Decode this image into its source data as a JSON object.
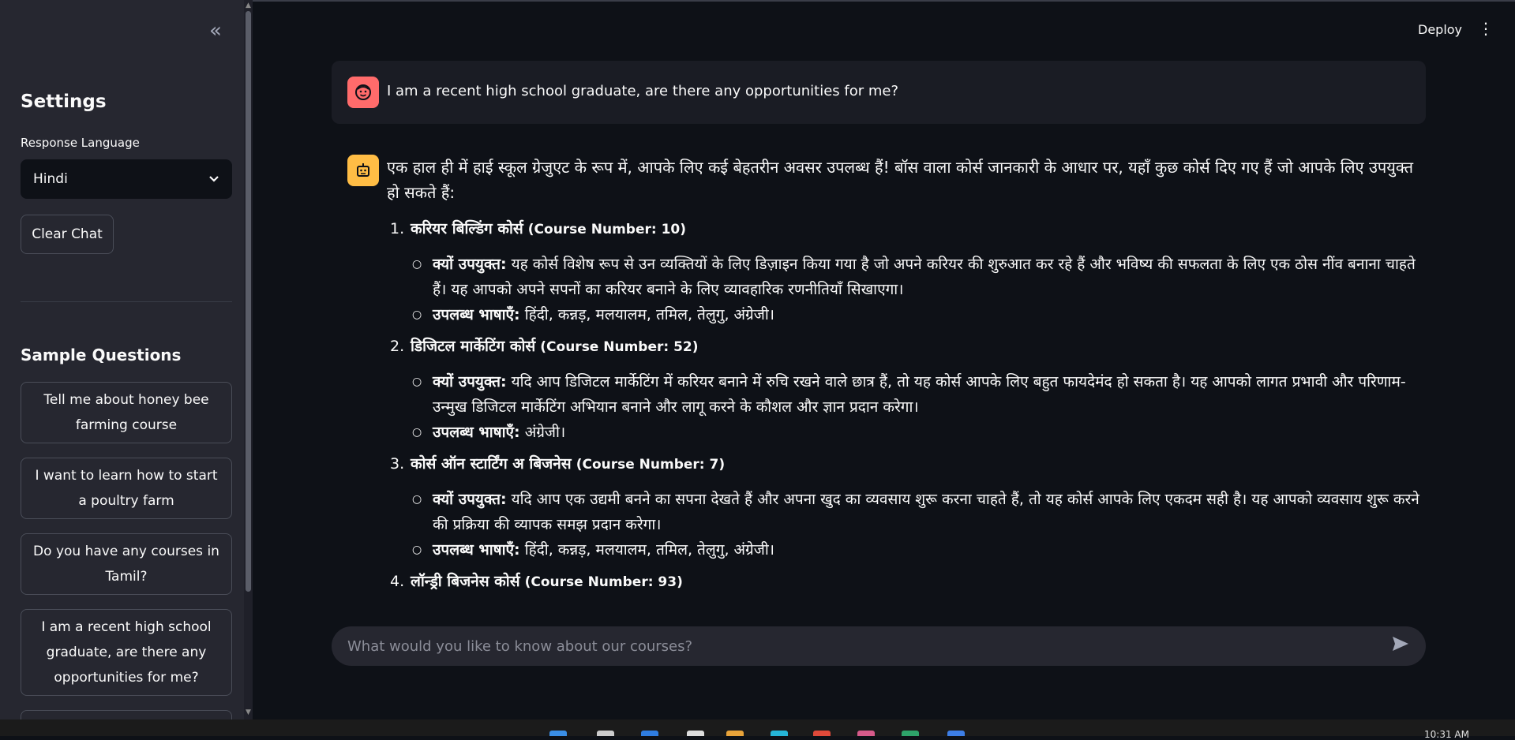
{
  "sidebar": {
    "settings_title": "Settings",
    "language_label": "Response Language",
    "language_value": "Hindi",
    "clear_chat": "Clear Chat",
    "sample_title": "Sample Questions",
    "questions": [
      "Tell me about honey bee farming course",
      "I want to learn how to start a poultry farm",
      "Do you have any courses in Tamil?",
      "I am a recent high school graduate, are there any opportunities for me?"
    ]
  },
  "header": {
    "deploy": "Deploy"
  },
  "chat": {
    "user_message": "I am a recent high school graduate, are there any opportunities for me?",
    "bot_intro": "एक हाल ही में हाई स्कूल ग्रेजुएट के रूप में, आपके लिए कई बेहतरीन अवसर उपलब्ध हैं! बॉस वाला कोर्स जानकारी के आधार पर, यहाँ कुछ कोर्स दिए गए हैं जो आपके लिए उपयुक्त हो सकते हैं:",
    "courses": [
      {
        "num": "1.",
        "name": "करियर बिल्डिंग कोर्स",
        "course_no": "(Course Number: 10)",
        "why_label": "क्यों उपयुक्त:",
        "why": "यह कोर्स विशेष रूप से उन व्यक्तियों के लिए डिज़ाइन किया गया है जो अपने करियर की शुरुआत कर रहे हैं और भविष्य की सफलता के लिए एक ठोस नींव बनाना चाहते हैं। यह आपको अपने सपनों का करियर बनाने के लिए व्यावहारिक रणनीतियाँ सिखाएगा।",
        "lang_label": "उपलब्ध भाषाएँ:",
        "langs": "हिंदी, कन्नड़, मलयालम, तमिल, तेलुगु, अंग्रेजी।"
      },
      {
        "num": "2.",
        "name": "डिजिटल मार्केटिंग कोर्स",
        "course_no": "(Course Number: 52)",
        "why_label": "क्यों उपयुक्त:",
        "why": "यदि आप डिजिटल मार्केटिंग में करियर बनाने में रुचि रखने वाले छात्र हैं, तो यह कोर्स आपके लिए बहुत फायदेमंद हो सकता है। यह आपको लागत प्रभावी और परिणाम-उन्मुख डिजिटल मार्केटिंग अभियान बनाने और लागू करने के कौशल और ज्ञान प्रदान करेगा।",
        "lang_label": "उपलब्ध भाषाएँ:",
        "langs": "अंग्रेजी।"
      },
      {
        "num": "3.",
        "name": "कोर्स ऑन स्टार्टिंग अ बिजनेस",
        "course_no": "(Course Number: 7)",
        "why_label": "क्यों उपयुक्त:",
        "why": "यदि आप एक उद्यमी बनने का सपना देखते हैं और अपना खुद का व्यवसाय शुरू करना चाहते हैं, तो यह कोर्स आपके लिए एकदम सही है। यह आपको व्यवसाय शुरू करने की प्रक्रिया की व्यापक समझ प्रदान करेगा।",
        "lang_label": "उपलब्ध भाषाएँ:",
        "langs": "हिंदी, कन्नड़, मलयालम, तमिल, तेलुगु, अंग्रेजी।"
      },
      {
        "num": "4.",
        "name": "लॉन्ड्री बिजनेस कोर्स",
        "course_no": "(Course Number: 93)"
      }
    ],
    "input_placeholder": "What would you like to know about our courses?"
  },
  "taskbar": {
    "clock": "10:31 AM"
  },
  "colors": {
    "bg": "#0e1117",
    "sidebar": "#262730",
    "user_avatar": "#ff6b6b",
    "bot_avatar": "#ffbd45"
  }
}
